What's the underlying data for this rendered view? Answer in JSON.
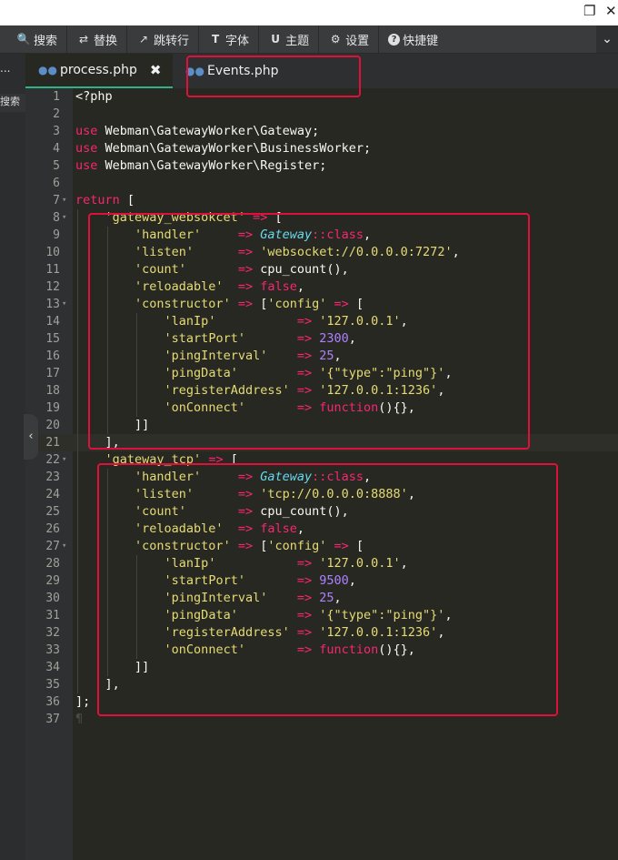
{
  "window": {
    "restore_glyph": "❐",
    "close_glyph": "✕"
  },
  "toolbar": {
    "items": [
      {
        "label": "搜索",
        "icon": "search-icon",
        "glyph": "🔍"
      },
      {
        "label": "替换",
        "icon": "replace-icon",
        "glyph": "⇄"
      },
      {
        "label": "跳转行",
        "icon": "goto-line-icon",
        "glyph": "↗"
      },
      {
        "label": "字体",
        "icon": "font-icon",
        "glyph": "T"
      },
      {
        "label": "主题",
        "icon": "theme-icon",
        "glyph": "U"
      },
      {
        "label": "设置",
        "icon": "gear-icon",
        "glyph": "⚙"
      },
      {
        "label": "快捷键",
        "icon": "help-icon",
        "glyph": "?"
      }
    ],
    "chevron_glyph": "⌄"
  },
  "sidebar": {
    "ellipsis": "...",
    "search_label": "搜索",
    "collapse_glyph": "‹"
  },
  "tabs": [
    {
      "label": "process.php",
      "icon": "php-elephant-icon",
      "active": true,
      "close_glyph": "✖"
    },
    {
      "label": "Events.php",
      "icon": "php-elephant-icon",
      "active": false
    }
  ],
  "editor": {
    "current_line": 21,
    "lines": [
      "<?php",
      "",
      "use Webman\\GatewayWorker\\Gateway;",
      "use Webman\\GatewayWorker\\BusinessWorker;",
      "use Webman\\GatewayWorker\\Register;",
      "",
      "return [",
      "    'gateway_websokcet' => [",
      "        'handler'     => Gateway::class,",
      "        'listen'      => 'websocket://0.0.0.0:7272',",
      "        'count'       => cpu_count(),",
      "        'reloadable'  => false,",
      "        'constructor' => ['config' => [",
      "            'lanIp'           => '127.0.0.1',",
      "            'startPort'       => 2300,",
      "            'pingInterval'    => 25,",
      "            'pingData'        => '{\"type\":\"ping\"}',",
      "            'registerAddress' => '127.0.0.1:1236',",
      "            'onConnect'       => function(){},",
      "        ]]",
      "    ],",
      "    'gateway_tcp' => [",
      "        'handler'     => Gateway::class,",
      "        'listen'      => 'tcp://0.0.0.0:8888',",
      "        'count'       => cpu_count(),",
      "        'reloadable'  => false,",
      "        'constructor' => ['config' => [",
      "            'lanIp'           => '127.0.0.1',",
      "            'startPort'       => 9500,",
      "            'pingInterval'    => 25,",
      "            'pingData'        => '{\"type\":\"ping\"}',",
      "            'registerAddress' => '127.0.0.1:1236',",
      "            'onConnect'       => function(){},",
      "        ]]",
      "    ],",
      "];",
      ""
    ],
    "fold_lines": [
      7,
      8,
      13,
      22,
      27
    ],
    "pilcrow": "¶"
  },
  "colors": {
    "background": "#272822",
    "keyword": "#f92672",
    "string": "#e6db74",
    "number": "#ae81ff",
    "class": "#66d9ef",
    "annotation_red": "#e0103a",
    "tab_accent": "#2fb28a"
  }
}
